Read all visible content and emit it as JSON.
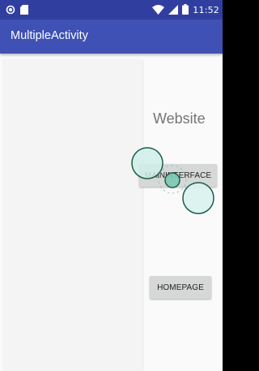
{
  "status_bar": {
    "time": "11:52",
    "icons": [
      "notification-circle-icon",
      "sd-card-icon",
      "wifi-icon",
      "cellular-signal-icon",
      "battery-icon"
    ],
    "background": "#303f9f"
  },
  "app_bar": {
    "title": "MultipleActivity",
    "background": "#3f51b5"
  },
  "main": {
    "heading": "Website",
    "buttons": {
      "main_interface": "MAININTERFACE",
      "homepage": "HOMEPAGE"
    }
  },
  "colors": {
    "accent": "#3f51b5",
    "touch_fill": "#b2dfdb",
    "touch_stroke": "#1b5e4a"
  }
}
